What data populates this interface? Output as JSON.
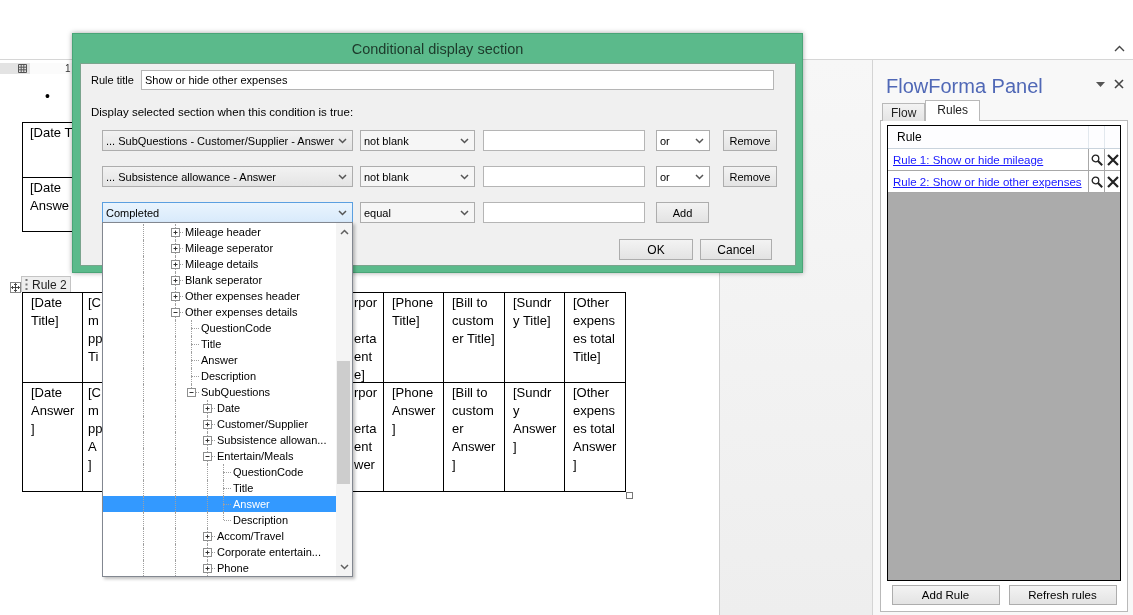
{
  "ruler": {
    "label": "1"
  },
  "document": {
    "bullet": "•",
    "table_1": {
      "rows": [
        {
          "cells": [
            "[Date T"
          ]
        },
        {
          "cells": [
            "[Date\nAnswe"
          ]
        }
      ]
    },
    "section_tag": "Rule 2",
    "table_2": {
      "rows": [
        {
          "cells": [
            "[Date Title]",
            "[C\nm\npp\nTi",
            "rpor\n\nerta\nent\ne]",
            "[Phone Title]",
            "[Bill to customer Title]",
            "[Sundry Title]",
            "[Other expenses total Title]"
          ]
        },
        {
          "cells": [
            "[Date Answer]",
            "[C\nm\npp\nA\n]",
            "rpor\n\nerta\nent\nwer",
            "[Phone Answer]",
            "[Bill to customer Answer]",
            "[Sundry Answer]",
            "[Other expenses total Answer]"
          ]
        }
      ]
    }
  },
  "dialog": {
    "title": "Conditional display section",
    "rule_title": {
      "label": "Rule title",
      "value": "Show or hide other expenses"
    },
    "instruction": "Display selected section when this condition is true:",
    "conditions": [
      {
        "kind": "condition",
        "field": "... SubQuestions - Customer/Supplier - Answer",
        "field_open": false,
        "operator": "not blank",
        "join": "or",
        "button": "Remove"
      },
      {
        "kind": "condition",
        "field": "... Subsistence allowance - Answer",
        "field_open": false,
        "operator": "not blank",
        "join": "or",
        "button": "Remove"
      },
      {
        "kind": "new",
        "field": "Completed",
        "field_open": true,
        "operator": "equal",
        "button": "Add"
      }
    ],
    "buttons": [
      "OK",
      "Cancel"
    ]
  },
  "field_dropdown": {
    "items": [
      {
        "label": "Mileage header",
        "expanded": false,
        "selected": false
      },
      {
        "label": "Mileage seperator",
        "expanded": false,
        "selected": false
      },
      {
        "label": "Mileage details",
        "expanded": false,
        "selected": false
      },
      {
        "label": "Blank seperator",
        "expanded": false,
        "selected": false
      },
      {
        "label": "Other expenses header",
        "expanded": false,
        "selected": false
      },
      {
        "label": "Other expenses details",
        "expanded": true,
        "selected": false,
        "children": [
          {
            "label": "QuestionCode",
            "selected": false
          },
          {
            "label": "Title",
            "selected": false
          },
          {
            "label": "Answer",
            "selected": false
          },
          {
            "label": "Description",
            "selected": false
          },
          {
            "label": "SubQuestions",
            "expanded": true,
            "selected": false,
            "children": [
              {
                "label": "Date",
                "expanded": false,
                "selected": false
              },
              {
                "label": "Customer/Supplier",
                "expanded": false,
                "selected": false
              },
              {
                "label": "Subsistence allowan...",
                "expanded": false,
                "selected": false
              },
              {
                "label": "Entertain/Meals",
                "expanded": true,
                "selected": false,
                "children": [
                  {
                    "label": "QuestionCode",
                    "selected": false
                  },
                  {
                    "label": "Title",
                    "selected": false
                  },
                  {
                    "label": "Answer",
                    "selected": true
                  },
                  {
                    "label": "Description",
                    "selected": false
                  }
                ]
              },
              {
                "label": "Accom/Travel",
                "expanded": false,
                "selected": false
              },
              {
                "label": "Corporate entertain...",
                "expanded": false,
                "selected": false
              },
              {
                "label": "Phone",
                "expanded": false,
                "selected": false
              }
            ]
          }
        ]
      }
    ]
  },
  "panel": {
    "title": "FlowForma Panel",
    "tabs": [
      {
        "label": "Flow",
        "selected": false
      },
      {
        "label": "Rules",
        "selected": true
      }
    ],
    "rules_table": {
      "column": "Rule",
      "rows": [
        "Rule 1: Show or hide mileage",
        "Rule 2: Show or hide other expenses"
      ]
    },
    "buttons": [
      "Add Rule",
      "Refresh rules"
    ]
  }
}
